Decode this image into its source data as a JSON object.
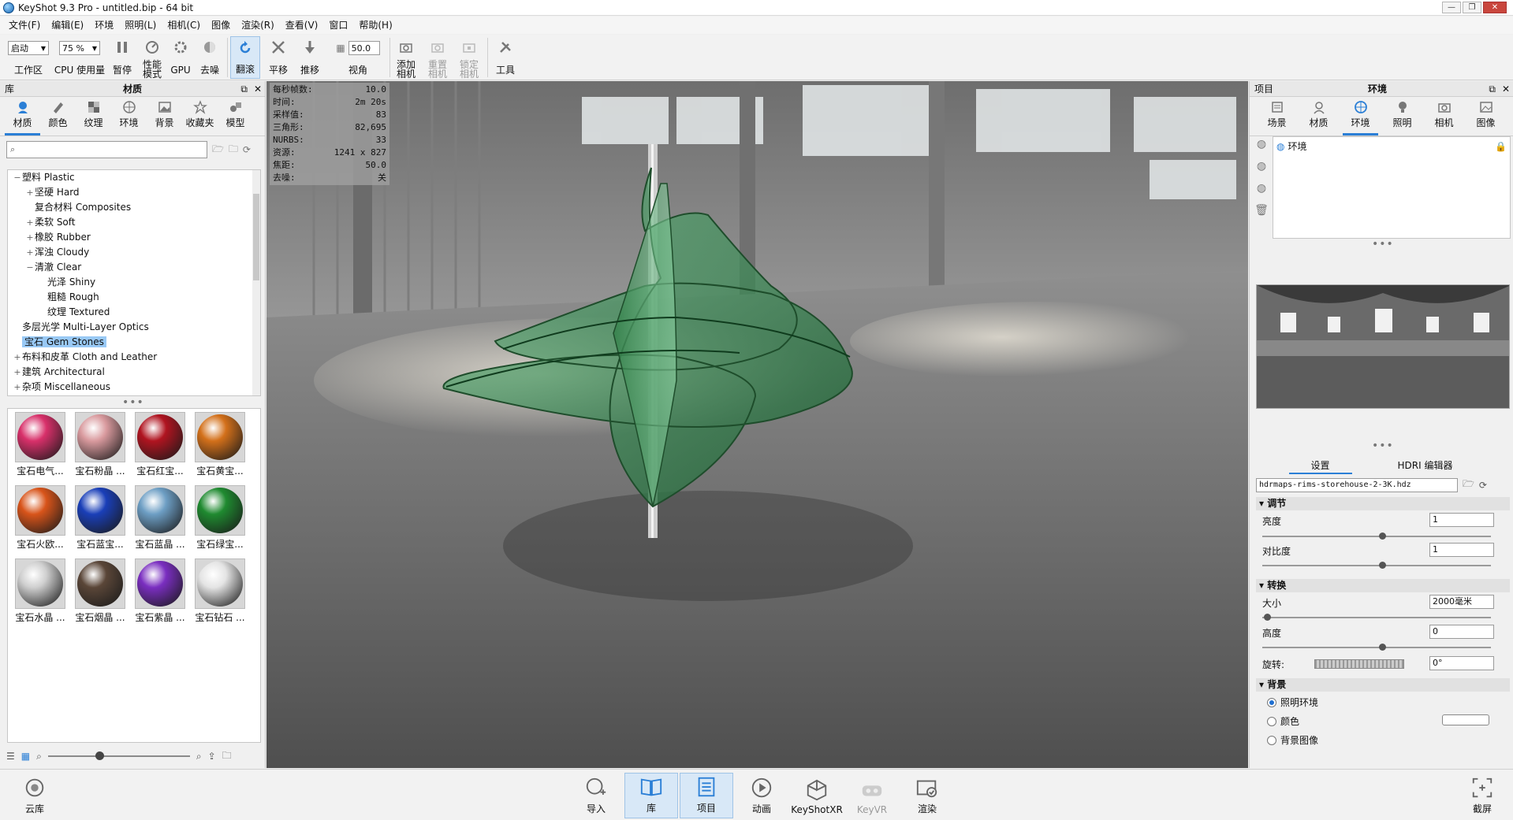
{
  "titlebar": {
    "title": "KeyShot 9.3 Pro  - untitled.bip  - 64 bit"
  },
  "menu": [
    "文件(F)",
    "编辑(E)",
    "环境",
    "照明(L)",
    "相机(C)",
    "图像",
    "渲染(R)",
    "查看(V)",
    "窗口",
    "帮助(H)"
  ],
  "toolbar": {
    "workspace_value": "启动",
    "workspace_label": "工作区",
    "cpu_value": "75 %",
    "cpu_label": "CPU 使用量",
    "pause_label": "暂停",
    "perf_label": "性能\n模式",
    "gpu_label": "GPU",
    "denoise_label": "去噪",
    "tumble_label": "翻滚",
    "pan_label": "平移",
    "dolly_label": "推移",
    "fov_value": "50.0",
    "fov_label": "视角",
    "add_camera_label": "添加\n相机",
    "reset_camera_label": "重置\n相机",
    "lock_camera_label": "锁定\n相机",
    "tools_label": "工具"
  },
  "library": {
    "header_left": "库",
    "header_title": "材质",
    "tabs": [
      {
        "label": "材质",
        "icon": "material-icon"
      },
      {
        "label": "颜色",
        "icon": "color-icon"
      },
      {
        "label": "纹理",
        "icon": "texture-icon"
      },
      {
        "label": "环境",
        "icon": "environment-icon"
      },
      {
        "label": "背景",
        "icon": "background-icon"
      },
      {
        "label": "收藏夹",
        "icon": "favorites-icon"
      },
      {
        "label": "模型",
        "icon": "model-icon"
      }
    ],
    "search_placeholder": "",
    "tree": [
      {
        "label": "塑料 Plastic",
        "level": 1,
        "exp": "−"
      },
      {
        "label": "坚硬 Hard",
        "level": 2,
        "exp": "+"
      },
      {
        "label": "复合材料 Composites",
        "level": 2,
        "exp": ""
      },
      {
        "label": "柔软 Soft",
        "level": 2,
        "exp": "+"
      },
      {
        "label": "橡胶 Rubber",
        "level": 2,
        "exp": "+"
      },
      {
        "label": "浑浊 Cloudy",
        "level": 2,
        "exp": "+"
      },
      {
        "label": "清澈 Clear",
        "level": 2,
        "exp": "−"
      },
      {
        "label": "光泽 Shiny",
        "level": 3,
        "exp": ""
      },
      {
        "label": "粗糙 Rough",
        "level": 3,
        "exp": ""
      },
      {
        "label": "纹理 Textured",
        "level": 3,
        "exp": ""
      },
      {
        "label": "多层光学 Multi-Layer Optics",
        "level": 1,
        "exp": ""
      },
      {
        "label": "宝石 Gem Stones",
        "level": 1,
        "exp": "",
        "selected": true
      },
      {
        "label": "布料和皮革 Cloth and Leather",
        "level": 1,
        "exp": "+"
      },
      {
        "label": "建筑 Architectural",
        "level": 1,
        "exp": "+"
      },
      {
        "label": "杂项 Miscellaneous",
        "level": 1,
        "exp": "+"
      }
    ],
    "materials": [
      {
        "label": "宝石电气...",
        "color": "#d8306a"
      },
      {
        "label": "宝石粉晶 ...",
        "color": "#d99a9e"
      },
      {
        "label": "宝石红宝...",
        "color": "#b01420"
      },
      {
        "label": "宝石黄宝...",
        "color": "#d3701a"
      },
      {
        "label": "宝石火欧...",
        "color": "#d8541a"
      },
      {
        "label": "宝石蓝宝...",
        "color": "#1a3fb8"
      },
      {
        "label": "宝石蓝晶 ...",
        "color": "#6d9ec4"
      },
      {
        "label": "宝石绿宝...",
        "color": "#1f8a30"
      },
      {
        "label": "宝石水晶 ...",
        "color": "#cfcfcf"
      },
      {
        "label": "宝石烟晶 ...",
        "color": "#5a4638"
      },
      {
        "label": "宝石紫晶 ...",
        "color": "#7a2ec0"
      },
      {
        "label": "宝石钻石 ...",
        "color": "#e4e4e4"
      }
    ]
  },
  "stats": [
    {
      "k": "每秒帧数:",
      "v": "10.0"
    },
    {
      "k": "时间:",
      "v": "2m 20s"
    },
    {
      "k": "采样值:",
      "v": "83"
    },
    {
      "k": "三角形:",
      "v": "82,695"
    },
    {
      "k": "NURBS:",
      "v": "33"
    },
    {
      "k": "资源:",
      "v": "1241 x 827"
    },
    {
      "k": "焦距:",
      "v": "50.0"
    },
    {
      "k": "去噪:",
      "v": "关"
    }
  ],
  "project": {
    "header_left": "项目",
    "header_title": "环境",
    "tabs": [
      {
        "label": "场景",
        "icon": "scene-icon"
      },
      {
        "label": "材质",
        "icon": "material-icon"
      },
      {
        "label": "环境",
        "icon": "environment-icon"
      },
      {
        "label": "照明",
        "icon": "lighting-icon"
      },
      {
        "label": "相机",
        "icon": "camera-icon"
      },
      {
        "label": "图像",
        "icon": "image-icon"
      }
    ],
    "env_item": "环境",
    "sub_tabs": [
      "设置",
      "HDRI 编辑器"
    ],
    "hdri_file": "hdrmaps-rims-storehouse-2-3K.hdz",
    "adjust_title": "调节",
    "brightness_label": "亮度",
    "brightness_value": "1",
    "contrast_label": "对比度",
    "contrast_value": "1",
    "transform_title": "转换",
    "size_label": "大小",
    "size_value": "2000毫米",
    "height_label": "高度",
    "height_value": "0",
    "rotation_label": "旋转:",
    "rotation_value": "0°",
    "background_title": "背景",
    "bg_options": [
      "照明环境",
      "颜色",
      "背景图像"
    ]
  },
  "bottombar": {
    "cloud_label": "云库",
    "buttons": [
      {
        "label": "导入",
        "icon": "import-icon"
      },
      {
        "label": "库",
        "icon": "library-icon"
      },
      {
        "label": "项目",
        "icon": "project-icon"
      },
      {
        "label": "动画",
        "icon": "animation-icon"
      },
      {
        "label": "KeyShotXR",
        "icon": "keyshotxr-icon"
      },
      {
        "label": "KeyVR",
        "icon": "keyvr-icon"
      },
      {
        "label": "渲染",
        "icon": "render-icon"
      }
    ],
    "screenshot_label": "截屏"
  },
  "colors": {
    "accent": "#2b7fd6",
    "selection": "#99c9f5",
    "glass_green": "#3f9a5c"
  }
}
